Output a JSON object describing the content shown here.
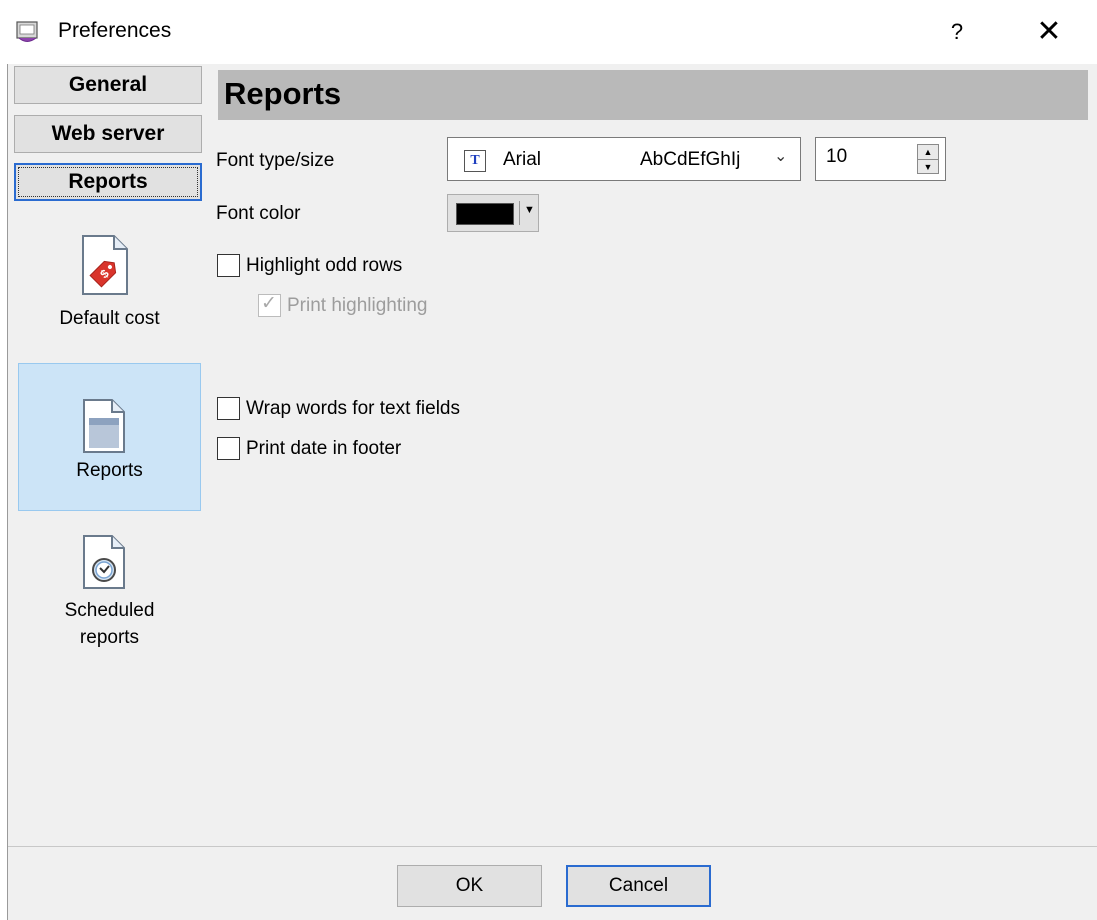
{
  "window": {
    "title": "Preferences",
    "help_label": "?",
    "close_label": "✕"
  },
  "tabs": [
    {
      "label": "General",
      "active": false
    },
    {
      "label": "Web server",
      "active": false
    },
    {
      "label": "Reports",
      "active": true
    }
  ],
  "nav": [
    {
      "label": "Default cost",
      "icon": "price-tag-document-icon",
      "selected": false
    },
    {
      "label": "Reports",
      "icon": "report-document-icon",
      "selected": true
    },
    {
      "label_lines": [
        "Scheduled",
        "reports"
      ],
      "icon": "clock-document-icon",
      "selected": false
    }
  ],
  "section": {
    "title": "Reports"
  },
  "font": {
    "label": "Font type/size",
    "icon_glyph": "T",
    "name": "Arial",
    "sample": "AbCdEfGhIj",
    "size": "10"
  },
  "font_color": {
    "label": "Font color",
    "value": "#000000"
  },
  "options": {
    "highlight_odd_rows": {
      "label": "Highlight odd rows",
      "checked": false
    },
    "print_highlighting": {
      "label": "Print highlighting",
      "checked": true,
      "disabled": true
    },
    "wrap_words": {
      "label": "Wrap words for text fields",
      "checked": false
    },
    "print_date": {
      "label": "Print date in footer",
      "checked": false
    }
  },
  "buttons": {
    "ok": "OK",
    "cancel": "Cancel"
  },
  "colors": {
    "accent": "#2a6bd0",
    "selection": "#cce4f7",
    "header_bg": "#b9b9b9"
  }
}
